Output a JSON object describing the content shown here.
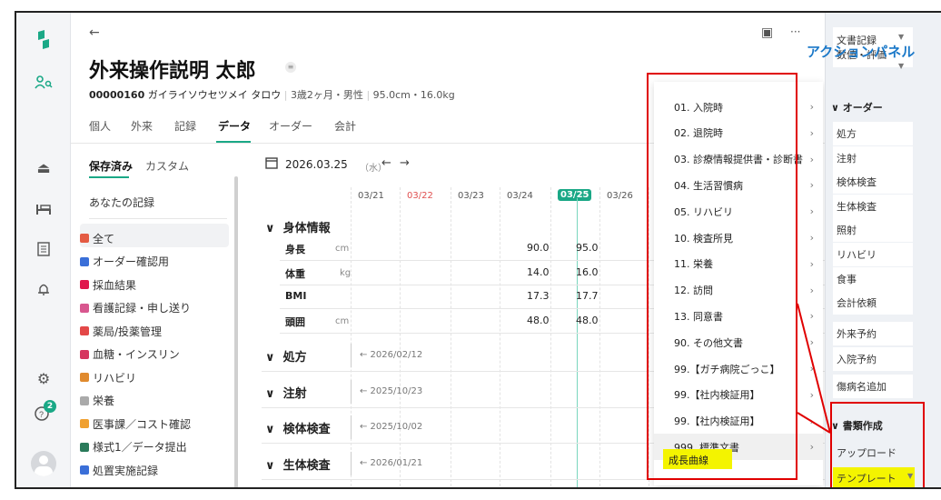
{
  "patient": {
    "name": "外来操作説明 太郎",
    "id": "00000160",
    "kana": "ガイライソウセツメイ タロウ",
    "age_sex": "3歳2ヶ月・男性",
    "measure": "95.0cm・16.0kg"
  },
  "tabs": [
    "個人",
    "外来",
    "記録",
    "データ",
    "オーダー",
    "会計"
  ],
  "filter_tabs": [
    "保存済み",
    "カスタム"
  ],
  "your_records": "あなたの記録",
  "nav_items": [
    {
      "label": "全て",
      "color": "#e45b43"
    },
    {
      "label": "オーダー確認用",
      "color": "#3a6fd8"
    },
    {
      "label": "採血結果",
      "color": "#e0174d"
    },
    {
      "label": "看護記録・申し送り",
      "color": "#d8578f"
    },
    {
      "label": "薬局/投薬管理",
      "color": "#e34848"
    },
    {
      "label": "血糖・インスリン",
      "color": "#d6365f"
    },
    {
      "label": "リハビリ",
      "color": "#e08a2e"
    },
    {
      "label": "栄養",
      "color": "#aaa"
    },
    {
      "label": "医事課／コスト確認",
      "color": "#f0a030"
    },
    {
      "label": "様式1／データ提出",
      "color": "#2a7a5a"
    },
    {
      "label": "処置実施記録",
      "color": "#3a6fd8"
    }
  ],
  "date": {
    "value": "2026.03.25",
    "dow": "（水）"
  },
  "dates": [
    "03/21",
    "03/22",
    "03/23",
    "03/24",
    "03/25",
    "03/26"
  ],
  "body_info": {
    "title": "身体情報",
    "rows": [
      {
        "label": "身長",
        "unit": "cm",
        "v1": "90.0",
        "v2": "95.0"
      },
      {
        "label": "体重",
        "unit": "kg",
        "v1": "14.0",
        "v2": "16.0"
      },
      {
        "label": "BMI",
        "unit": "",
        "v1": "17.3",
        "v2": "17.7"
      },
      {
        "label": "頭囲",
        "unit": "cm",
        "v1": "48.0",
        "v2": "48.0"
      }
    ]
  },
  "sections": [
    {
      "title": "処方",
      "prev": "← 2026/02/12"
    },
    {
      "title": "注射",
      "prev": "← 2025/10/23"
    },
    {
      "title": "検体検査",
      "prev": "← 2025/10/02"
    },
    {
      "title": "生体検査",
      "prev": "← 2026/01/21"
    }
  ],
  "dropdown": [
    "01. 入院時",
    "02. 退院時",
    "03. 診療情報提供書・診断書",
    "04. 生活習慣病",
    "05. リハビリ",
    "10. 検査所見",
    "11. 栄養",
    "12. 訪問",
    "13. 同意書",
    "90. その他文書",
    "99.【ガチ病院ごっこ】",
    "99.【社内検証用】",
    "99.【社内検証用】",
    "999. 標準文書"
  ],
  "dropdown_highlight": "成長曲線",
  "right_panel": {
    "docrec": "文書記録",
    "vals": "数値・評価",
    "order_head": "オーダー",
    "order_items": [
      "処方",
      "注射",
      "検体検査",
      "生体検査",
      "照射",
      "リハビリ",
      "食事",
      "会計依頼"
    ],
    "visit": "外来予約",
    "admit": "入院予約",
    "disease": "傷病名追加",
    "doc_head": "書類作成",
    "upload": "アップロード",
    "template": "テンプレート"
  },
  "annotation": "アクションパネル",
  "badge_count": "2",
  "colors": {
    "accent": "#1aa886",
    "red": "#e00000",
    "highlight": "#f4f400",
    "annot": "#1a78c8"
  }
}
